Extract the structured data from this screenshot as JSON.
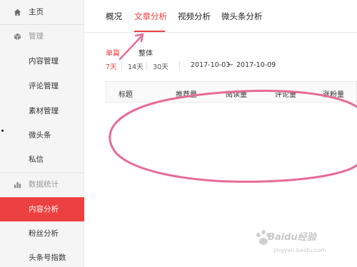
{
  "sidebar": {
    "items": [
      {
        "label": "主页",
        "icon": "home-icon"
      },
      {
        "label": "管理",
        "icon": "cube-icon"
      },
      {
        "label": "内容管理"
      },
      {
        "label": "评论管理"
      },
      {
        "label": "素材管理"
      },
      {
        "label": "微头条"
      },
      {
        "label": "私信"
      },
      {
        "label": "数据统计",
        "icon": "bar-chart-icon"
      },
      {
        "label": "内容分析"
      },
      {
        "label": "粉丝分析"
      },
      {
        "label": "头条号指数"
      }
    ]
  },
  "tabs": [
    {
      "label": "概况"
    },
    {
      "label": "文章分析"
    },
    {
      "label": "视频分析"
    },
    {
      "label": "微头条分析"
    }
  ],
  "subtabs": [
    {
      "label": "单篇"
    },
    {
      "label": "整体"
    }
  ],
  "ranges": [
    {
      "label": "7天"
    },
    {
      "label": "14天"
    },
    {
      "label": "30天"
    }
  ],
  "date_range": {
    "start": "2017-10-03",
    "separator": "~",
    "end": "2017-10-09"
  },
  "table": {
    "columns": [
      "标题",
      "推荐量",
      "阅读量",
      "评论量",
      "涨粉量"
    ]
  },
  "watermark": {
    "text": "Baidu经验",
    "url": "jingyan.baidu.com"
  },
  "colors": {
    "accent": "#ed4040",
    "annotation": "#e66b96"
  }
}
